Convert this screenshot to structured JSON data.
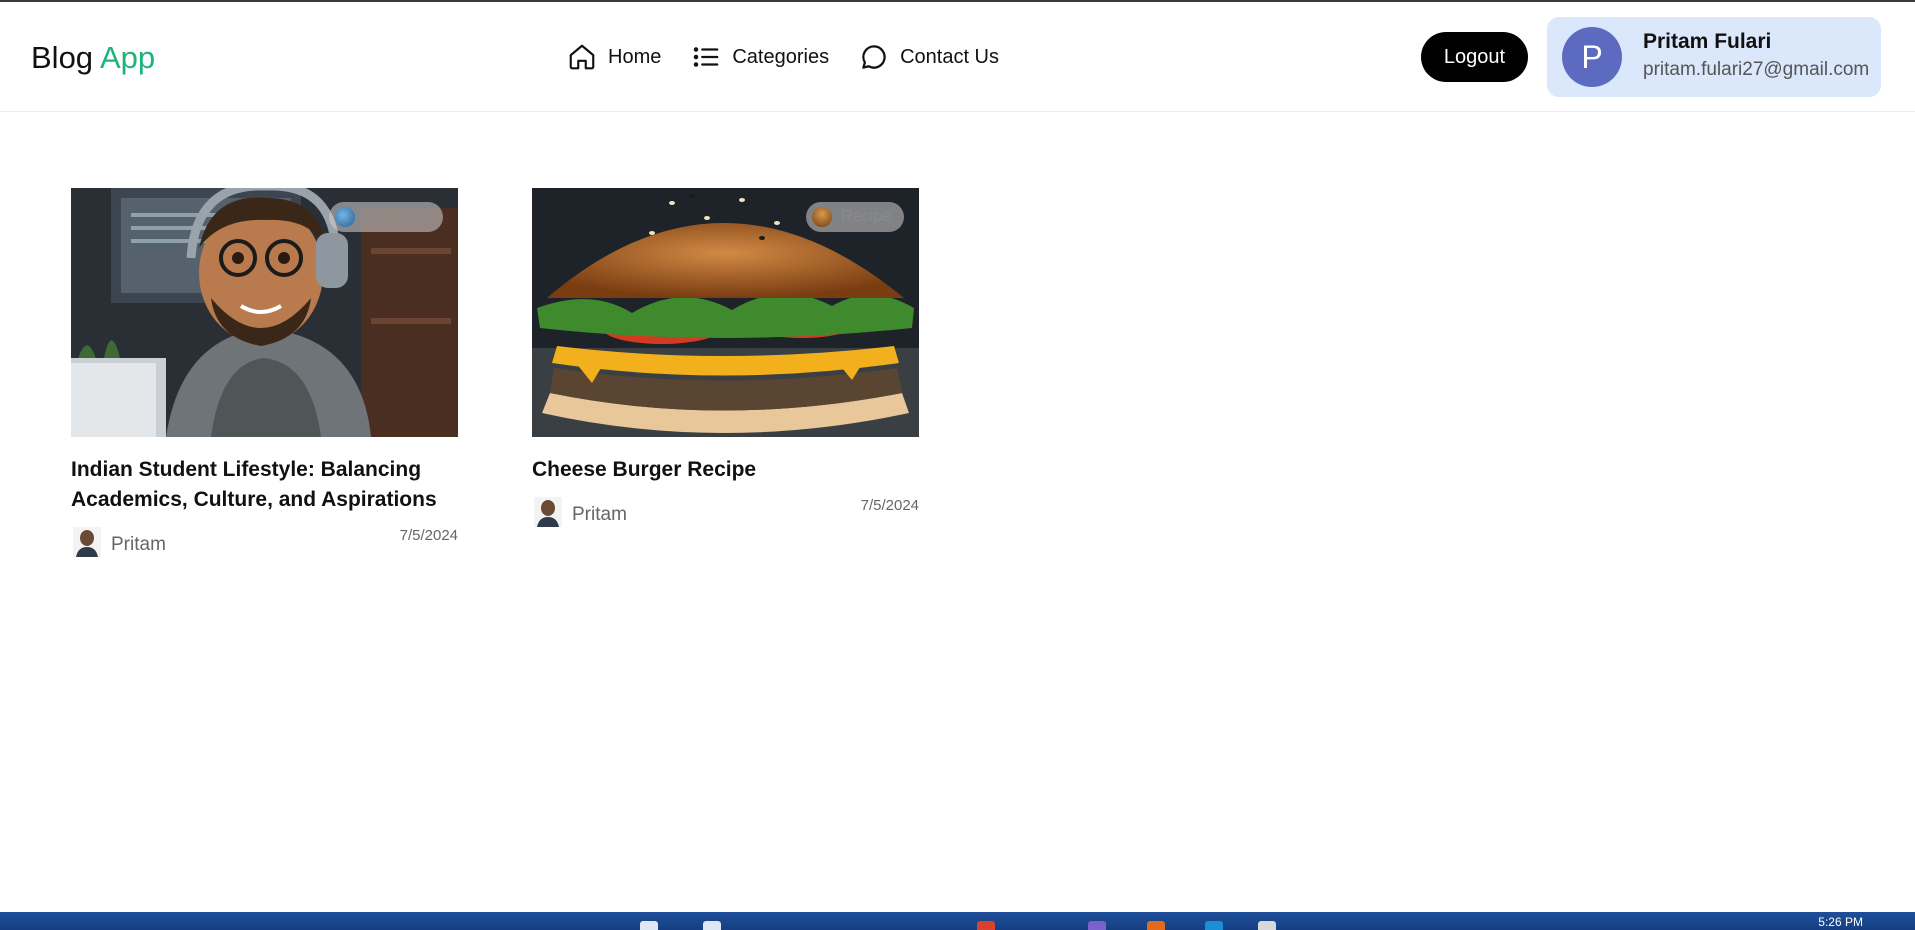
{
  "brand": {
    "part1": "Blog",
    "part2": "App"
  },
  "nav": [
    {
      "label": "Home",
      "icon": "home-icon"
    },
    {
      "label": "Categories",
      "icon": "list-icon"
    },
    {
      "label": "Contact Us",
      "icon": "chat-bubble-icon"
    }
  ],
  "header": {
    "logout_label": "Logout"
  },
  "user": {
    "avatar_letter": "P",
    "name": "Pritam Fulari",
    "email": "pritam.fulari27@gmail.com"
  },
  "posts": [
    {
      "title": "Indian Student Lifestyle: Balancing Academics, Culture, and Aspirations",
      "category": "Life Style",
      "author": "Pritam",
      "date": "7/5/2024"
    },
    {
      "title": "Cheese Burger Recipe",
      "category": "Recipe",
      "author": "Pritam",
      "date": "7/5/2024"
    }
  ],
  "taskbar": {
    "clock": "5:26 PM"
  },
  "colors": {
    "brand_accent": "#1db37a",
    "avatar_bg": "#5c6bc0",
    "user_card_bg": "#dbe8fb",
    "logout_bg": "#000000"
  }
}
